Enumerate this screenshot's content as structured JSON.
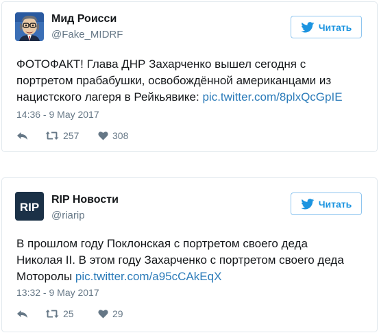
{
  "tweets": [
    {
      "display_name": "Мид Роисси",
      "handle": "@Fake_MIDRF",
      "follow_label": "Читать",
      "text_lines": [
        "ФОТОФАКТ! Глава ДНР Захарченко вышел сегодня с",
        "портретом прабабушки, освобождённой американцами из",
        "нацистского лагеря в Рейкьявике: "
      ],
      "link": "pic.twitter.com/8plxQcGpIE",
      "timestamp": "14:36 - 9 May 2017",
      "retweets": "257",
      "likes": "308",
      "avatar_icon": "caricature-avatar"
    },
    {
      "display_name": "RIP Новости",
      "handle": "@riarip",
      "follow_label": "Читать",
      "text_lines": [
        "В прошлом году Поклонская с портретом своего деда",
        "Николая II. В этом году Захарченко с портретом своего деда",
        "Моторолы "
      ],
      "link": "pic.twitter.com/a95cCAkEqX",
      "timestamp": "13:32 - 9 May 2017",
      "retweets": "25",
      "likes": "29",
      "avatar_icon": "rip-logo",
      "avatar_text": "RIP"
    }
  ],
  "colors": {
    "accent": "#1c94e0",
    "link": "#2b7bb9",
    "muted": "#657786",
    "border": "#e1e8ed"
  },
  "icons": [
    "twitter-bird-icon",
    "reply-icon",
    "retweet-icon",
    "heart-icon"
  ]
}
